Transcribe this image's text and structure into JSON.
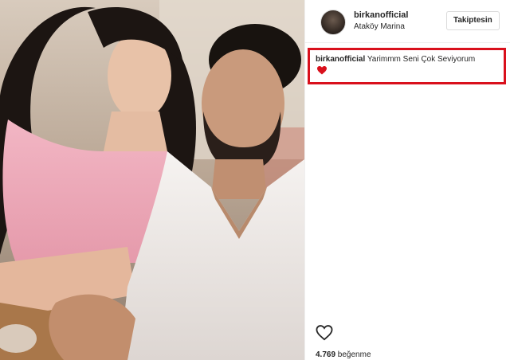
{
  "post": {
    "username": "birkanofficial",
    "location": "Ataköy Marina",
    "follow_label": "Takiptesin",
    "caption_user": "birkanofficial",
    "caption_text": " Yarimmm Seni Çok Seviyorum",
    "likes_count": "4.769",
    "likes_suffix": " beğenme"
  },
  "colors": {
    "highlight_border": "#d9101c",
    "heart": "#d9101c"
  },
  "icons": [
    "heart-emoji-icon",
    "like-heart-icon"
  ]
}
